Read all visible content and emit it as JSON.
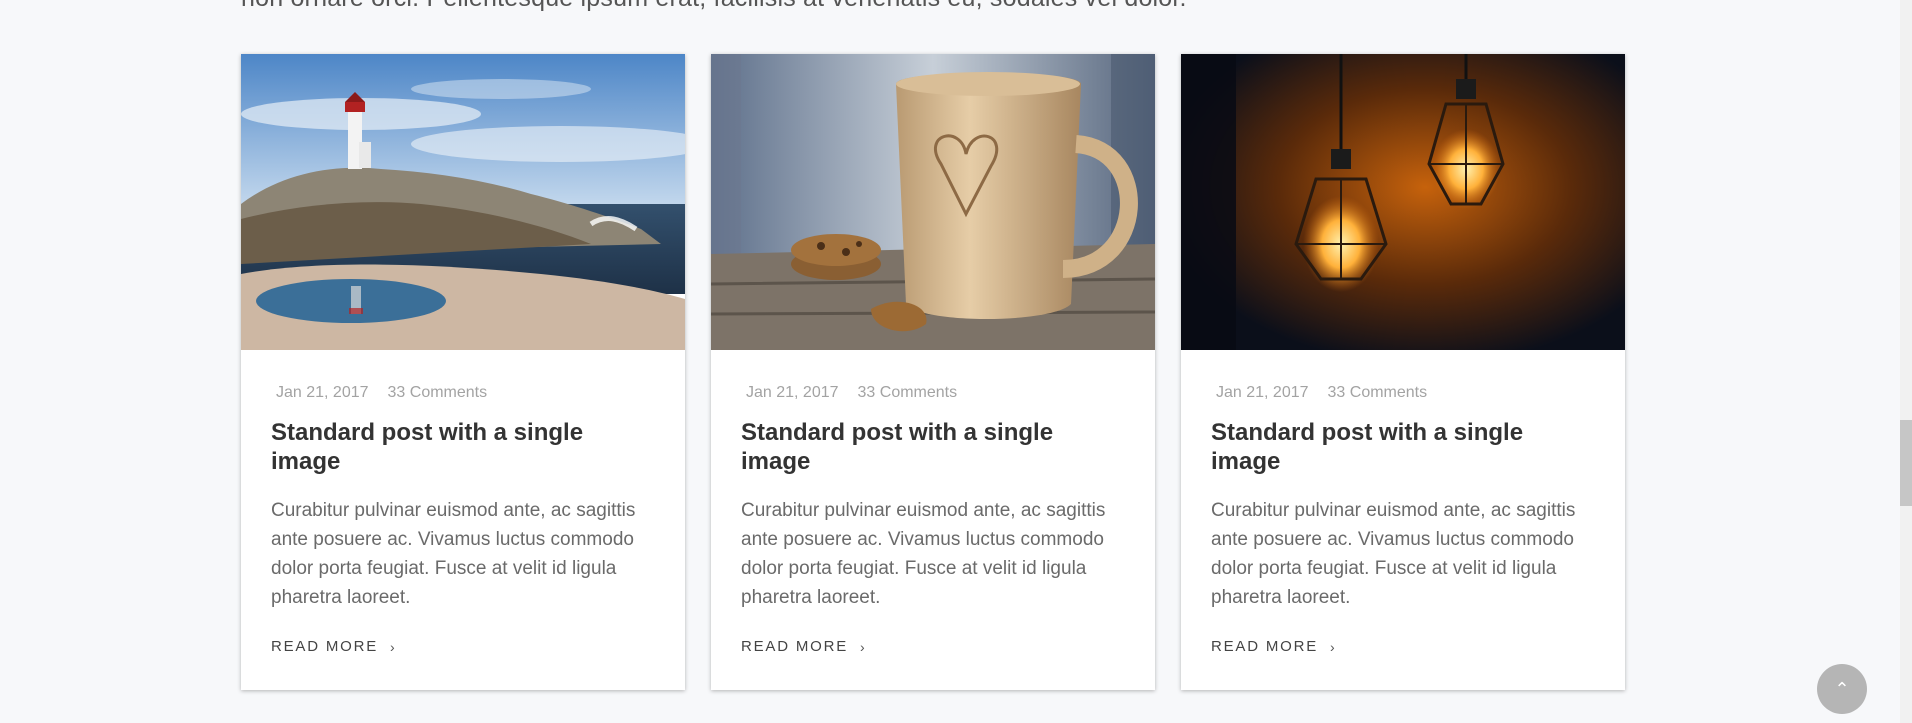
{
  "intro": {
    "text": "non ornare orci. Pellentesque ipsum erat, facilisis at venenatis eu, sodales vel dolor."
  },
  "posts": [
    {
      "image": "lighthouse-photo",
      "date": "Jan 21, 2017",
      "comments": "33 Comments",
      "title": "Standard post with a single image",
      "excerpt": "Curabitur pulvinar euismod ante, ac sagittis ante posuere ac. Vivamus luctus commodo dolor porta feugiat. Fusce at velit id ligula pharetra laoreet.",
      "read_more": "READ MORE"
    },
    {
      "image": "coffee-mug-photo",
      "date": "Jan 21, 2017",
      "comments": "33 Comments",
      "title": "Standard post with a single image",
      "excerpt": "Curabitur pulvinar euismod ante, ac sagittis ante posuere ac. Vivamus luctus commodo dolor porta feugiat. Fusce at velit id ligula pharetra laoreet.",
      "read_more": "READ MORE"
    },
    {
      "image": "light-bulbs-photo",
      "date": "Jan 21, 2017",
      "comments": "33 Comments",
      "title": "Standard post with a single image",
      "excerpt": "Curabitur pulvinar euismod ante, ac sagittis ante posuere ac. Vivamus luctus commodo dolor porta feugiat. Fusce at velit id ligula pharetra laoreet.",
      "read_more": "READ MORE"
    }
  ],
  "icons": {
    "read_more": "chevron-right-icon",
    "back_to_top": "chevron-up-icon"
  },
  "colors": {
    "background": "#f7f8fa",
    "card": "#ffffff",
    "meta_text": "#a3a3a3",
    "title_text": "#333333",
    "body_text": "#6a6a6a",
    "back_to_top": "#b5b5b5"
  }
}
